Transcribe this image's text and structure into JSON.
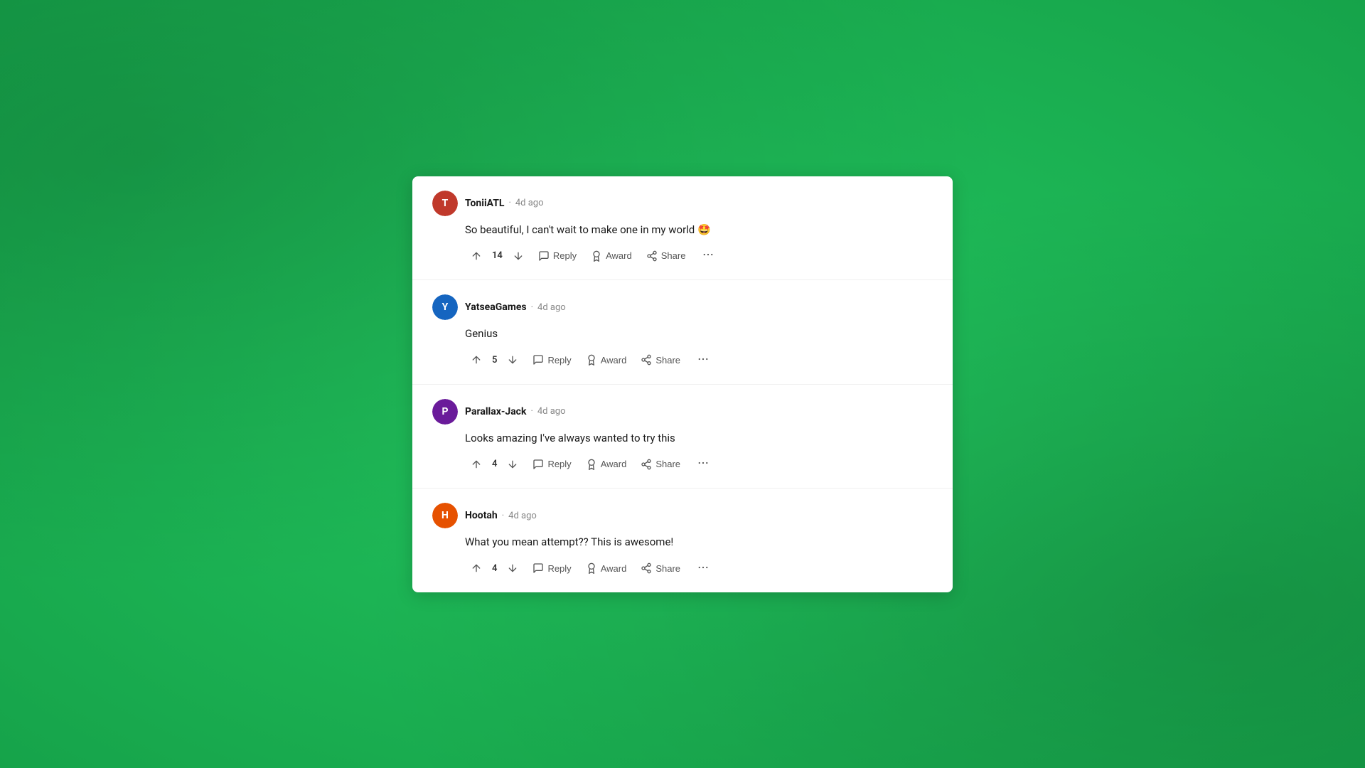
{
  "background": {
    "color": "#22c55e"
  },
  "comments": [
    {
      "id": "comment-1",
      "username": "ToniiATL",
      "timestamp": "4d ago",
      "body": "So beautiful, I can't wait to make one in my world 🤩",
      "upvotes": 14,
      "avatar_color": "#c0392b",
      "avatar_initials": "T"
    },
    {
      "id": "comment-2",
      "username": "YatseaGames",
      "timestamp": "4d ago",
      "body": "Genius",
      "upvotes": 5,
      "avatar_color": "#1565c0",
      "avatar_initials": "Y"
    },
    {
      "id": "comment-3",
      "username": "Parallax-Jack",
      "timestamp": "4d ago",
      "body": "Looks amazing I've always wanted to try this",
      "upvotes": 4,
      "avatar_color": "#6a1b9a",
      "avatar_initials": "P"
    },
    {
      "id": "comment-4",
      "username": "Hootah",
      "timestamp": "4d ago",
      "body": "What you mean attempt?? This is awesome!",
      "upvotes": 4,
      "avatar_color": "#e65100",
      "avatar_initials": "H"
    }
  ],
  "actions": {
    "reply": "Reply",
    "award": "Award",
    "share": "Share"
  }
}
